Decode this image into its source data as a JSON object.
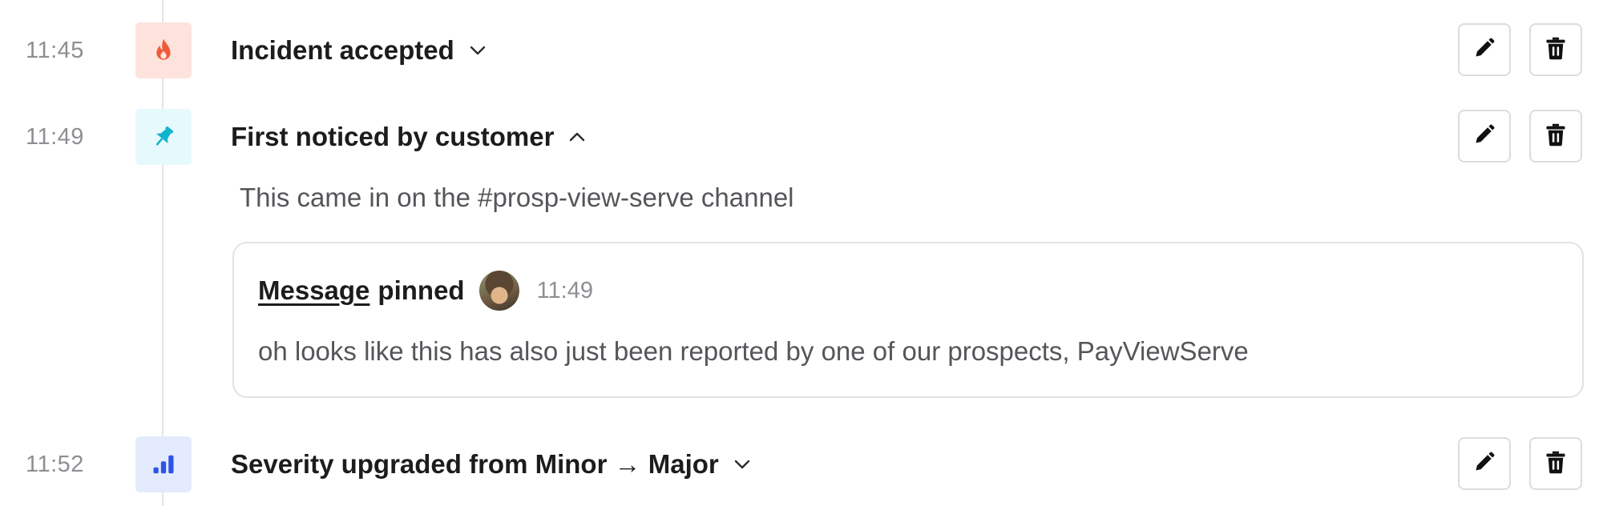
{
  "events": [
    {
      "time": "11:45",
      "title": "Incident accepted",
      "icon": "flame-icon",
      "icon_bg": "#fde3dc",
      "icon_color": "#f0593a",
      "expanded": false
    },
    {
      "time": "11:49",
      "title": "First noticed by customer",
      "icon": "pin-icon",
      "icon_bg": "#e6f9fc",
      "icon_color": "#12b3cc",
      "expanded": true,
      "description": "This came in on the #prosp-view-serve channel",
      "pinned": {
        "link_label": "Message",
        "suffix": "pinned",
        "time": "11:49",
        "message": "oh looks like this has also just been reported by one of our prospects, PayViewServe"
      }
    },
    {
      "time": "11:52",
      "title": "Severity upgraded from Minor → Major",
      "icon": "signal-bars-icon",
      "icon_bg": "#e3ebfd",
      "icon_color": "#2c54e8",
      "expanded": false
    }
  ],
  "actions": {
    "edit_icon": "pencil-icon",
    "delete_icon": "trash-icon"
  },
  "colors": {
    "timeline_line": "#e4e4e7",
    "muted_text": "#8e8e93",
    "body_text": "#55555a",
    "title_text": "#1c1c1e"
  }
}
